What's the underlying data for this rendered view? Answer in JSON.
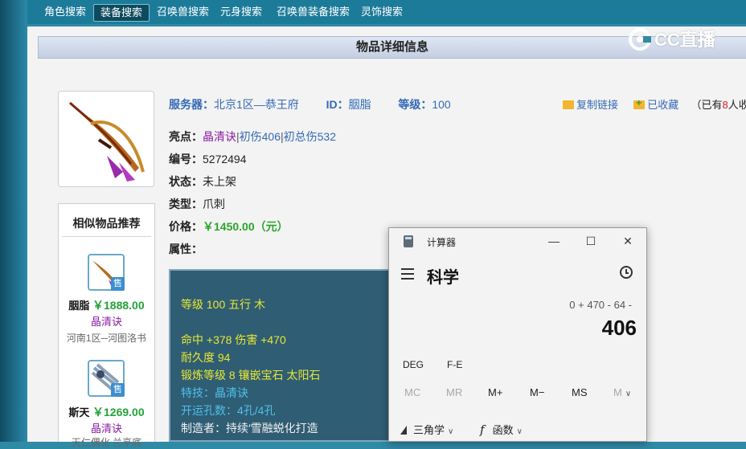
{
  "nav": {
    "tabs": [
      "角色搜索",
      "装备搜索",
      "召唤兽搜索",
      "元身搜索",
      "召唤兽装备搜索",
      "灵饰搜索"
    ],
    "active": "装备搜索"
  },
  "logo": {
    "text": "CC直播"
  },
  "section_title": "物品详细信息",
  "item": {
    "server_label": "服务器：",
    "server": "北京1区—恭王府",
    "id_label": "ID：",
    "id": "胭脂",
    "level_label": "等级：",
    "level": "100",
    "highlight_label": "亮点：",
    "highlight_tag": "晶清诀",
    "highlight_sep": "|",
    "highlight_v1": "初伤406",
    "highlight_v2": "初总伤532",
    "number_label": "编号：",
    "number": "5272494",
    "status_label": "状态：",
    "status": "未上架",
    "type_label": "类型：",
    "type": "爪刺",
    "price_label": "价格：",
    "price": "￥1450.00（元）",
    "attr_label": "属性："
  },
  "actions": {
    "copy_link": "复制链接",
    "collected": "已收藏",
    "count_prefix": "（已有",
    "count": "8",
    "count_suffix": "人收藏）"
  },
  "attributes": {
    "line1": "等级 100 五行 木",
    "line2": "命中 +378 伤害 +470",
    "line3": "耐久度 94",
    "line4": "锻炼等级 8 镶嵌宝石 太阳石",
    "line5": "特技：晶清诀",
    "line6": "开运孔数：4孔/4孔",
    "line7": "制造者：持续′雪融蜕化打造"
  },
  "recommend": {
    "title": "相似物品推荐",
    "sell_badge": "售",
    "items": [
      {
        "name": "胭脂",
        "price": "￥1888.00",
        "tag": "晶清诀",
        "server": "河南1区─河图洛书"
      },
      {
        "name": "斯天",
        "price": "￥1269.00",
        "tag": "晶清诀",
        "server": "天仁偶化 兰亭底"
      }
    ]
  },
  "calculator": {
    "title": "计算器",
    "mode": "科学",
    "expression": "0 + 470 - 64 -",
    "result": "406",
    "deg": "DEG",
    "fe": "F-E",
    "memory": [
      "MC",
      "MR",
      "M+",
      "M−",
      "MS",
      "M"
    ],
    "trig": "三角学",
    "func": "函数",
    "window_buttons": {
      "minimize": "—",
      "maximize": "☐",
      "close": "✕"
    }
  }
}
